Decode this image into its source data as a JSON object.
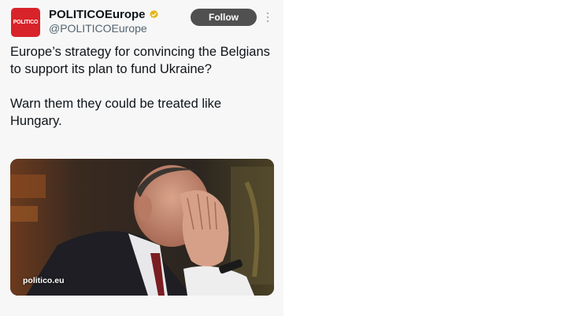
{
  "account": {
    "avatar_text": "POLITICO",
    "display_name": "POLITICOEurope",
    "handle": "@POLITICOEurope",
    "verified_icon": "gold-verified-badge-icon"
  },
  "actions": {
    "follow_label": "Follow",
    "more_icon": "vertical-ellipsis-icon"
  },
  "tweet": {
    "paragraphs": [
      "Europe’s strategy for convincing the Belgians to support its plan to fund Ukraine?",
      "Warn them they could be treated like Hungary."
    ]
  },
  "media": {
    "source": "politico.eu",
    "description_icon": "photo-man-covering-face-with-hands"
  },
  "colors": {
    "brand_red": "#d8232a",
    "verified_gold": "#e2b719",
    "follow_button": "#505050",
    "handle_gray": "#536471"
  }
}
